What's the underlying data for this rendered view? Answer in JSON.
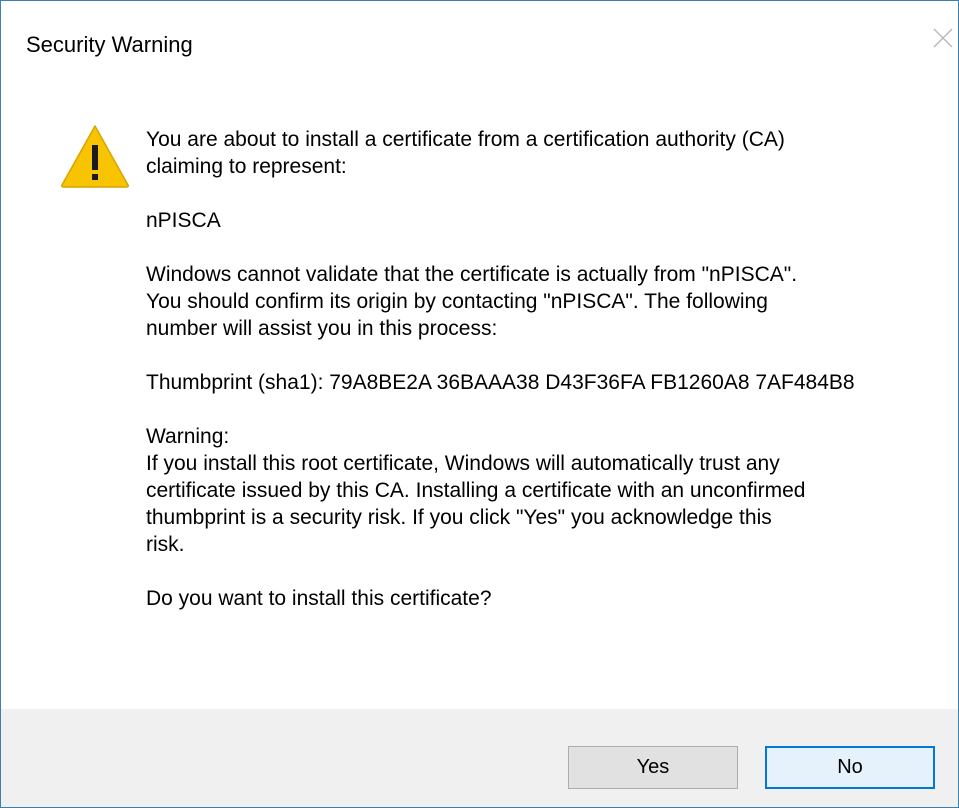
{
  "window": {
    "title": "Security Warning",
    "close_icon": "close-icon"
  },
  "icon": {
    "name": "warning-icon",
    "symbol": "!",
    "color": "#f5c000"
  },
  "message": {
    "intro": "You are about to install a certificate from a certification authority (CA)\nclaiming to represent:",
    "ca_name": "nPISCA",
    "validation": "Windows cannot validate that the certificate is actually from \"nPISCA\".\nYou should confirm its origin by contacting \"nPISCA\". The following\nnumber will assist you in this process:",
    "thumbprint": "Thumbprint (sha1): 79A8BE2A 36BAAA38 D43F36FA FB1260A8 7AF484B8",
    "warning": "Warning:\nIf you install this root certificate, Windows will automatically trust any\ncertificate issued by this CA. Installing a certificate with an unconfirmed\nthumbprint is a security risk. If you click \"Yes\" you acknowledge this\nrisk.",
    "question": "Do you want to install this certificate?"
  },
  "buttons": {
    "yes_label": "Yes",
    "no_label": "No"
  },
  "colors": {
    "accent": "#0078d7",
    "footer_bg": "#f0f0f0",
    "border": "#3c7fb1"
  }
}
